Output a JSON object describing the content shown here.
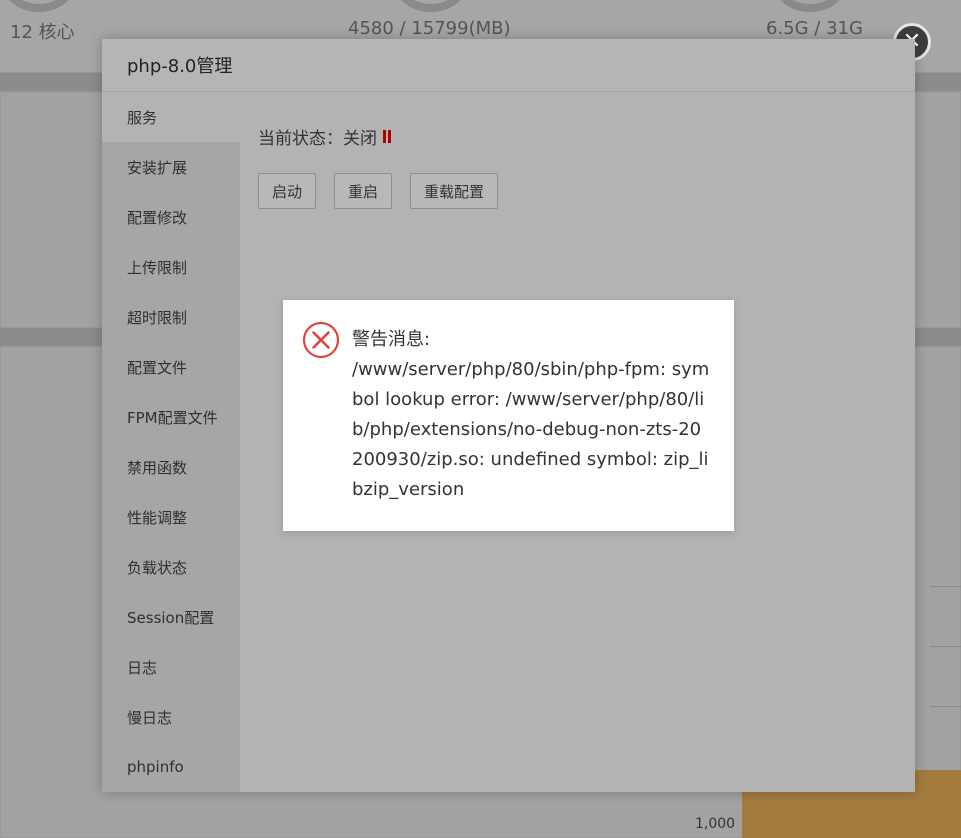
{
  "background": {
    "stats": [
      "12 核心",
      "4580 / 15799(MB)",
      "6.5G / 31G"
    ],
    "chart_axis_label": "1,000"
  },
  "dialog": {
    "title": "php-8.0管理",
    "close_icon": "close-icon",
    "sidebar": {
      "items": [
        {
          "label": "服务",
          "active": true
        },
        {
          "label": "安装扩展"
        },
        {
          "label": "配置修改"
        },
        {
          "label": "上传限制"
        },
        {
          "label": "超时限制"
        },
        {
          "label": "配置文件"
        },
        {
          "label": "FPM配置文件"
        },
        {
          "label": "禁用函数"
        },
        {
          "label": "性能调整"
        },
        {
          "label": "负载状态"
        },
        {
          "label": "Session配置"
        },
        {
          "label": "日志"
        },
        {
          "label": "慢日志"
        },
        {
          "label": "phpinfo"
        }
      ]
    },
    "service": {
      "status_text": "当前状态：关闭",
      "status_icon": "pause-icon",
      "status_color": "#b00000",
      "buttons": {
        "start": "启动",
        "restart": "重启",
        "reload": "重载配置"
      }
    }
  },
  "alert": {
    "icon": "error-circle-x-icon",
    "icon_color": "#e0453a",
    "title": "警告消息:",
    "message": "/www/server/php/80/sbin/php-fpm: symbol lookup error: /www/server/php/80/lib/php/extensions/no-debug-non-zts-20200930/zip.so: undefined symbol: zip_libzip_version"
  }
}
